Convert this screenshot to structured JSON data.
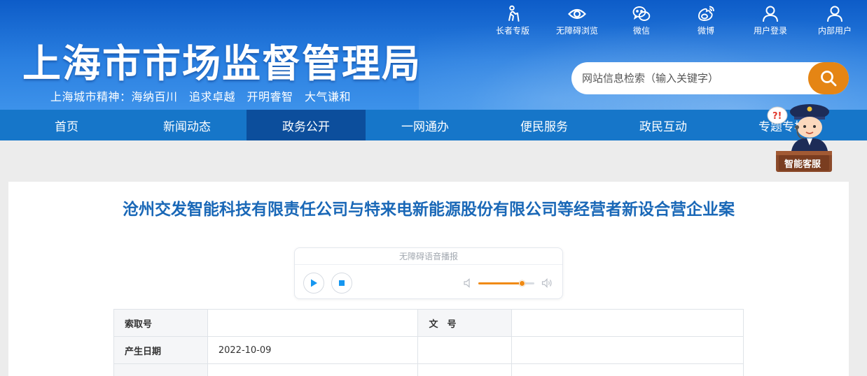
{
  "header": {
    "site_title": "上海市市场监督管理局",
    "slogan": "上海城市精神：海纳百川　追求卓越　开明睿智　大气谦和",
    "top_links": [
      {
        "label": "长者专版",
        "icon": "elder-icon"
      },
      {
        "label": "无障碍浏览",
        "icon": "eye-icon"
      },
      {
        "label": "微信",
        "icon": "wechat-icon"
      },
      {
        "label": "微博",
        "icon": "weibo-icon"
      },
      {
        "label": "用户登录",
        "icon": "user-icon"
      },
      {
        "label": "内部用户",
        "icon": "user-icon"
      }
    ],
    "search": {
      "placeholder": "网站信息检索（输入关键字）",
      "button_icon": "search-icon"
    }
  },
  "nav": {
    "items": [
      "首页",
      "新闻动态",
      "政务公开",
      "一网通办",
      "便民服务",
      "政民互动",
      "专题专栏"
    ],
    "active_index": 2
  },
  "assistant": {
    "label": "智能客服"
  },
  "article": {
    "title": "沧州交发智能科技有限责任公司与特来电新能源股份有限公司等经营者新设合营企业案",
    "audio": {
      "title": "无障碍语音播报",
      "volume_fraction": 0.78
    },
    "info": {
      "index_label": "索取号",
      "index_value": "",
      "doc_no_label": "文　号",
      "doc_no_value": "",
      "date_label": "产生日期",
      "date_value": "2022-10-09"
    }
  },
  "colors": {
    "header_blue": "#1f6fd6",
    "nav_blue": "#1676c9",
    "nav_active": "#0c4e9c",
    "title_blue": "#1a68b7",
    "accent_orange": "#e58514"
  }
}
